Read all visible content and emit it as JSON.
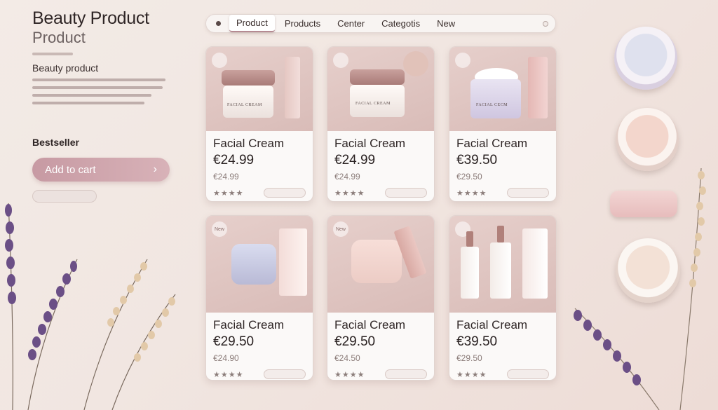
{
  "brand": {
    "title": "Beauty Product",
    "subtitle": "Product",
    "description_heading": "Beauty product",
    "bestseller_label": "Bestseller",
    "add_to_cart_label": "Add to cart",
    "add_to_cart_icon": "chevron-right-icon"
  },
  "nav": {
    "tabs": [
      {
        "label": "Product",
        "active": true
      },
      {
        "label": "Products",
        "active": false
      },
      {
        "label": "Center",
        "active": false
      },
      {
        "label": "Categotis",
        "active": false
      },
      {
        "label": "New",
        "active": false
      }
    ]
  },
  "products": [
    {
      "badge": "",
      "name": "Facial Cream",
      "price": "€24.99",
      "old_price": "€24.99",
      "stars": "★★★★",
      "jar_label": "FACIAL CREAM"
    },
    {
      "badge": "",
      "name": "Facial Cream",
      "price": "€24.99",
      "old_price": "€24.99",
      "stars": "★★★★",
      "jar_label": "FACIAL CREAM"
    },
    {
      "badge": "",
      "name": "Facial Cream",
      "price": "€39.50",
      "old_price": "€29.50",
      "stars": "★★★★",
      "jar_label": "FACIAL CECM"
    },
    {
      "badge": "New",
      "name": "Facial Cream",
      "price": "€29.50",
      "old_price": "€24.90",
      "stars": "★★★★",
      "jar_label": ""
    },
    {
      "badge": "New",
      "name": "Facial Cream",
      "price": "€29.50",
      "old_price": "€24.50",
      "stars": "★★★★",
      "jar_label": ""
    },
    {
      "badge": "",
      "name": "Facial Cream",
      "price": "€39.50",
      "old_price": "€29.50",
      "stars": "★★★★",
      "jar_label": ""
    }
  ],
  "colors": {
    "accent": "#c79aa3",
    "background": "#f1e6e1",
    "card": "#fbf9f8",
    "lavender": "#6b4f86"
  }
}
